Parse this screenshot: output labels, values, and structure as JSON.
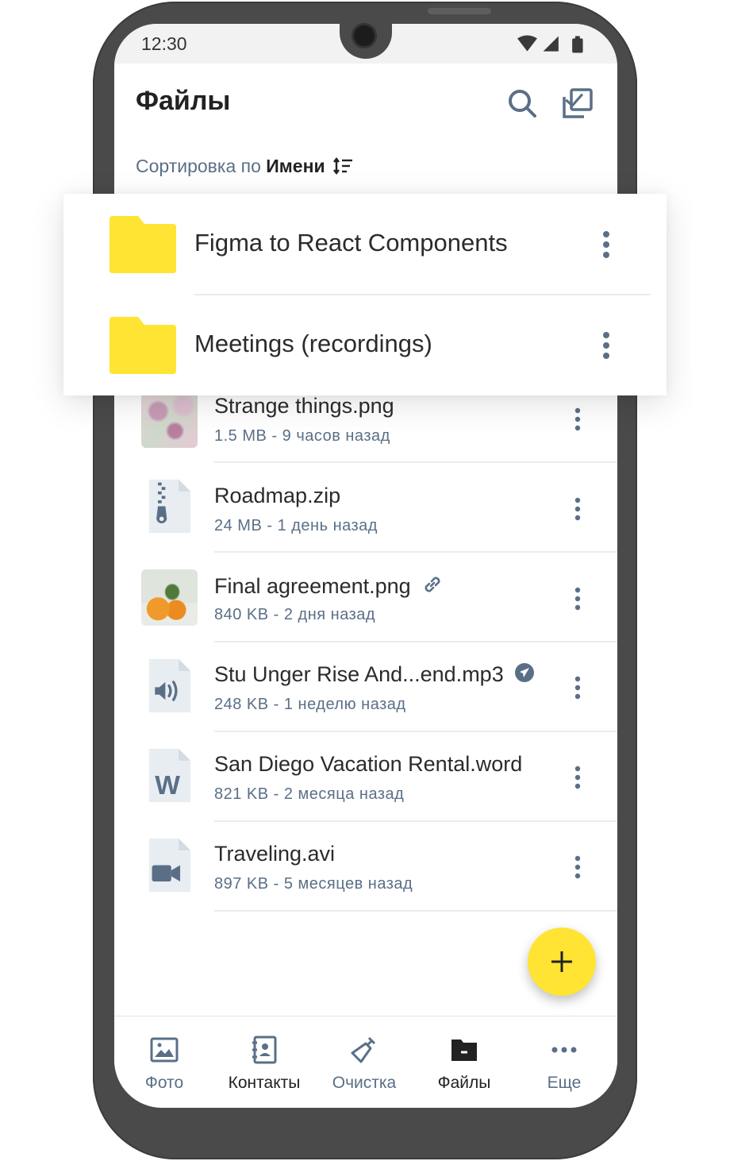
{
  "status_bar": {
    "time": "12:30"
  },
  "header": {
    "title": "Файлы"
  },
  "sort": {
    "prefix": "Сортировка по",
    "value": "Имени"
  },
  "folders": [
    {
      "name": "Figma to React Components"
    },
    {
      "name": "Meetings (recordings)"
    }
  ],
  "files": [
    {
      "name": "Strange things.png",
      "meta": "1.5 MB - 9 часов назад",
      "thumb": "image-flowers"
    },
    {
      "name": "Roadmap.zip",
      "meta": "24 MB - 1 день назад",
      "thumb": "zip-file-icon"
    },
    {
      "name": "Final agreement.png",
      "meta": "840 KB - 2 дня назад",
      "thumb": "image-tangerines",
      "badge": "link-icon"
    },
    {
      "name": "Stu Unger Rise And...end.mp3",
      "meta": "248 KB - 1 неделю назад",
      "thumb": "audio-file-icon",
      "badge": "airplane-icon"
    },
    {
      "name": "San Diego Vacation Rental.word",
      "meta": "821 KB - 2 месяца назад",
      "thumb": "word-file-icon"
    },
    {
      "name": "Traveling.avi",
      "meta": "897 KB - 5 месяцев назад",
      "thumb": "video-file-icon"
    }
  ],
  "bottom_nav": [
    {
      "label": "Фото",
      "icon": "photo-icon",
      "active": false
    },
    {
      "label": "Контакты",
      "icon": "contacts-icon",
      "active": false
    },
    {
      "label": "Очистка",
      "icon": "broom-icon",
      "active": false
    },
    {
      "label": "Файлы",
      "icon": "folder-icon",
      "active": true
    },
    {
      "label": "Еще",
      "icon": "more-icon",
      "active": false
    }
  ],
  "colors": {
    "accent": "#ffe433",
    "icon": "#5a6f87",
    "text": "#2b2b2b"
  }
}
